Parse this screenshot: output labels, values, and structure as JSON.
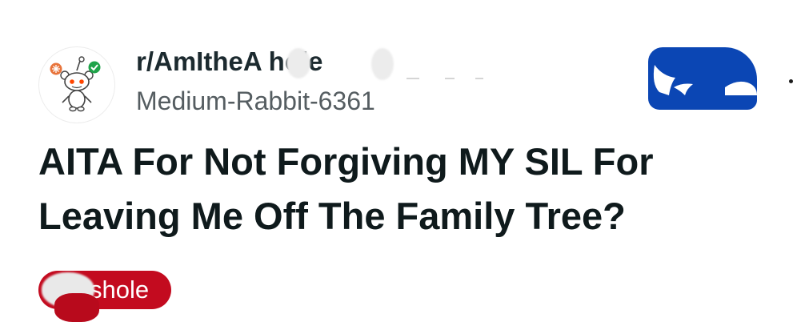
{
  "post": {
    "subreddit": "r/AmItheA hole",
    "username": "Medium-Rabbit-6361",
    "title": "AITA For Not Forgiving MY SIL For Leaving Me Off The Family Tree?",
    "flair": "shole"
  },
  "icons": {
    "avatar": "snoo-avatar-icon",
    "join": "join-button-graphic",
    "menu": "overflow-menu-icon"
  },
  "colors": {
    "join_button": "#0b46b4",
    "flair_bg": "#c30b1f",
    "avatar_badge_orange": "#e8743b",
    "avatar_badge_green": "#1fa34a"
  }
}
